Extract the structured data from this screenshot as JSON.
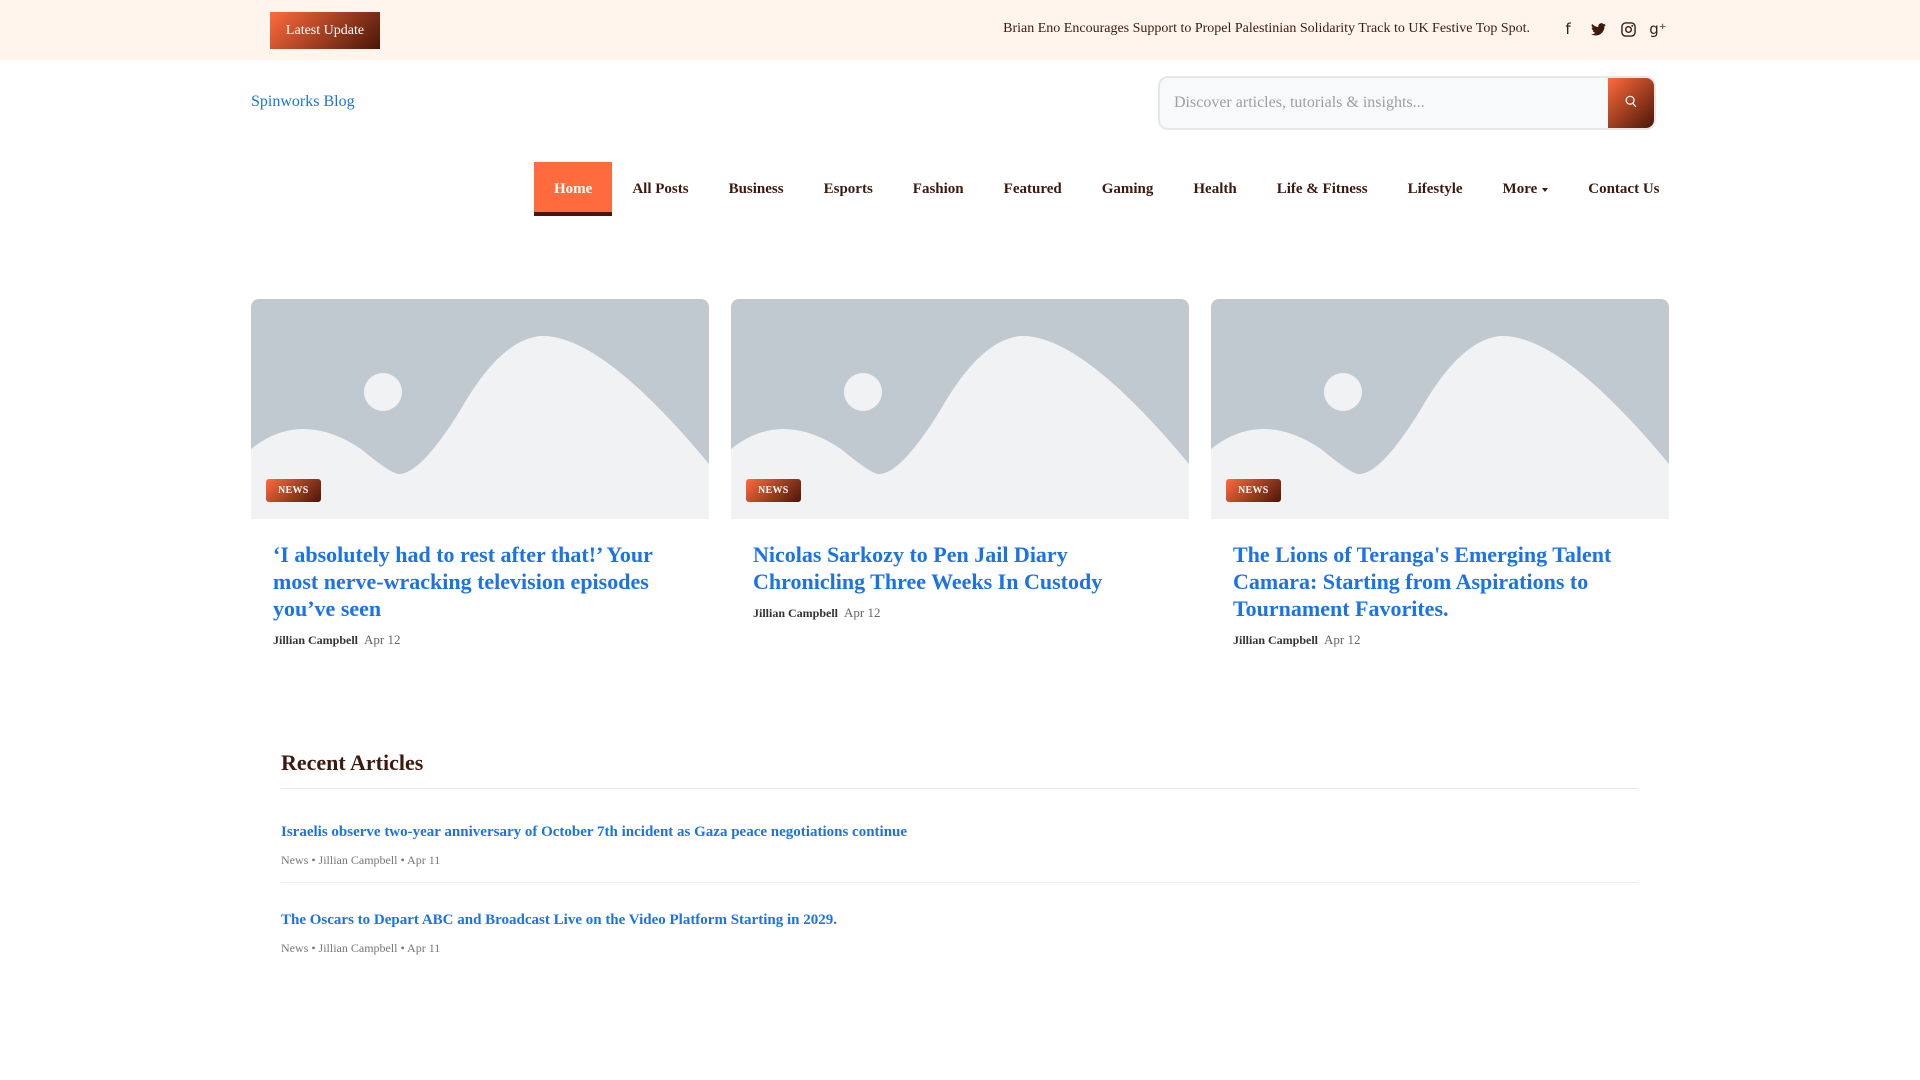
{
  "topbar": {
    "latest_label": "Latest Update",
    "ticker": "Brian Eno Encourages Support to Propel Palestinian Solidarity Track to UK Festive Top Spot.",
    "social": [
      "facebook-icon",
      "twitter-icon",
      "instagram-icon",
      "google-plus-icon"
    ]
  },
  "header": {
    "logo": "Spinworks Blog",
    "search_placeholder": "Discover articles, tutorials & insights..."
  },
  "nav": [
    "Home",
    "All Posts",
    "Business",
    "Esports",
    "Fashion",
    "Featured",
    "Gaming",
    "Health",
    "Life & Fitness",
    "Lifestyle",
    "More",
    "Contact Us"
  ],
  "cards": [
    {
      "badge": "NEWS",
      "title": "‘I absolutely had to rest after that!’ Your most nerve-wracking television episodes you’ve seen",
      "author": "Jillian Campbell",
      "date": "Apr 12"
    },
    {
      "badge": "NEWS",
      "title": "Nicolas Sarkozy to Pen Jail Diary Chronicling Three Weeks In Custody",
      "author": "Jillian Campbell",
      "date": "Apr 12"
    },
    {
      "badge": "NEWS",
      "title": "The Lions of Teranga's Emerging Talent Camara: Starting from Aspirations to Tournament Favorites.",
      "author": "Jillian Campbell",
      "date": "Apr 12"
    }
  ],
  "recent": {
    "heading": "Recent Articles",
    "items": [
      {
        "title": "Israelis observe two-year anniversary of October 7th incident as Gaza peace negotiations continue",
        "meta": "News • Jillian Campbell • Apr 11"
      },
      {
        "title": "The Oscars to Depart ABC and Broadcast Live on the Video Platform Starting in 2029.",
        "meta": "News • Jillian Campbell • Apr 11"
      }
    ]
  }
}
